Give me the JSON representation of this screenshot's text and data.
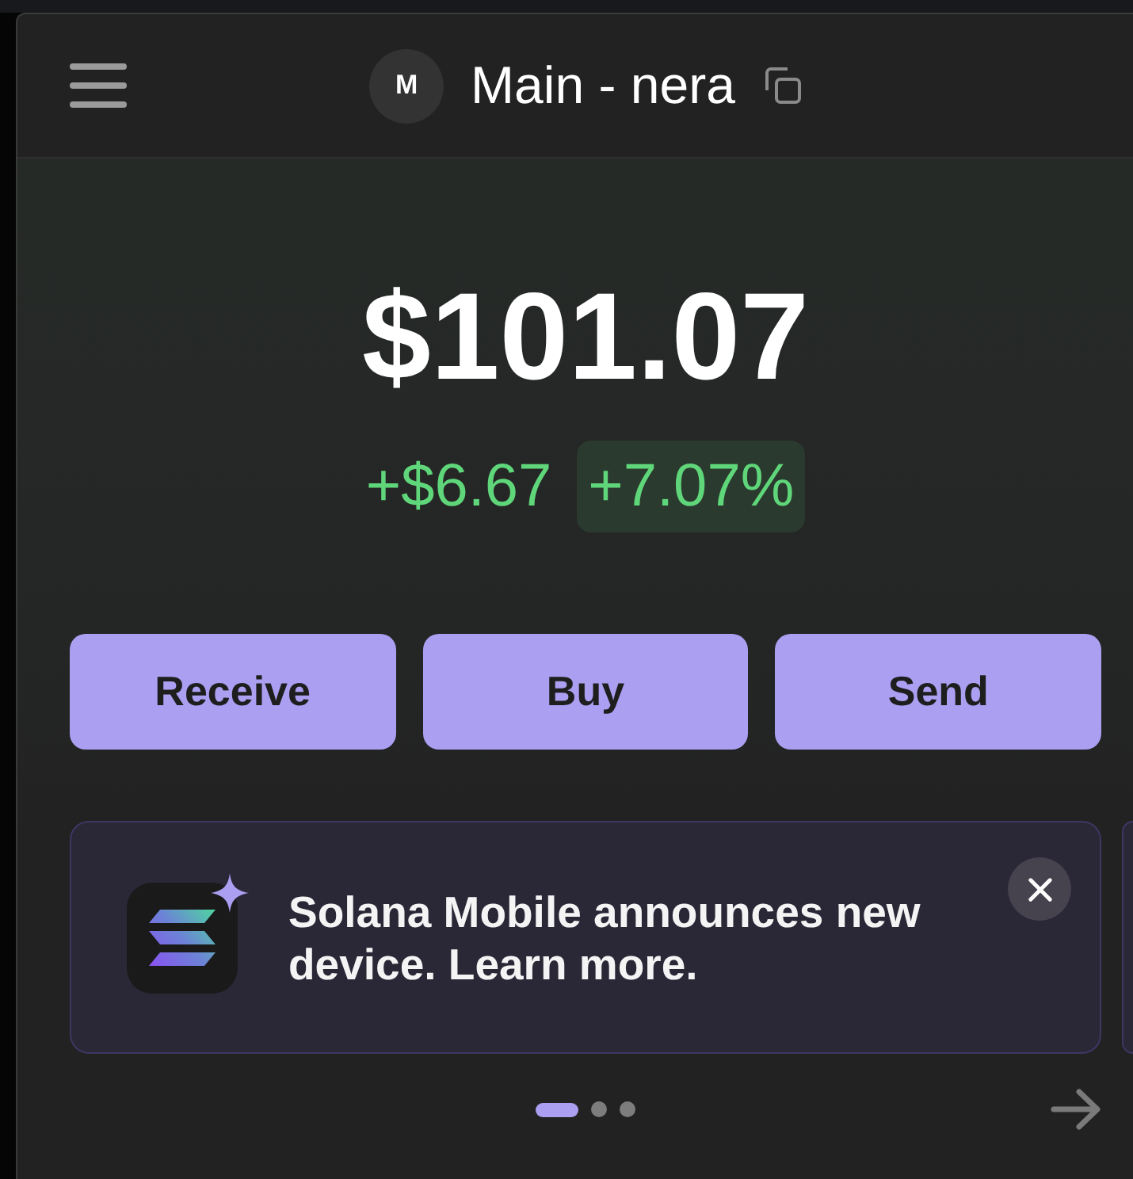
{
  "header": {
    "avatar_initial": "M",
    "account_name": "Main - nera"
  },
  "balance": {
    "amount": "$101.07",
    "change_value": "+$6.67",
    "change_percent": "+7.07%",
    "gain": true
  },
  "actions": [
    {
      "label": "Receive"
    },
    {
      "label": "Buy"
    },
    {
      "label": "Send"
    }
  ],
  "carousel": {
    "cards": [
      {
        "text": "Solana Mobile announces new device. Learn more."
      }
    ],
    "pages": [
      {
        "selected": true
      },
      {
        "selected": false
      },
      {
        "selected": false
      }
    ]
  }
}
